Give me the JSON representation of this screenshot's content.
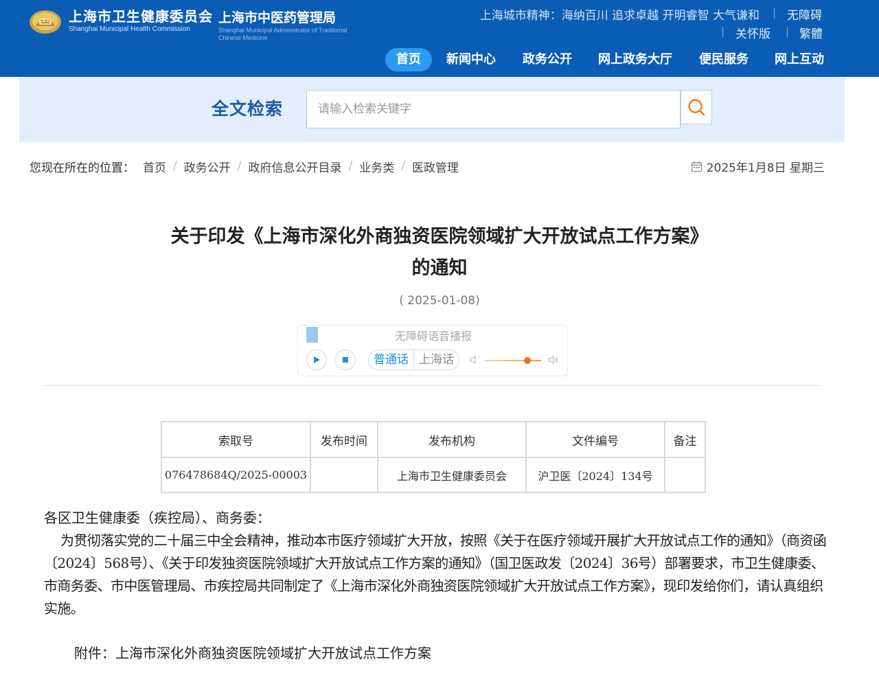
{
  "header": {
    "org_name": "上海市卫生健康委员会",
    "org_name_en": "Shanghai Municipal Health Commission",
    "org2_name": "上海市中医药管理局",
    "org2_name_en": "Shanghai Municipal Administrator of Traditional Chinese Medicine",
    "city_spirit": "上海城市精神：海纳百川 追求卓越 开明睿智 大气谦和",
    "accessibility_label": "无障碍",
    "care_label": "关怀版",
    "traditional_label": "繁體",
    "nav": [
      {
        "label": "首页"
      },
      {
        "label": "新闻中心"
      },
      {
        "label": "政务公开"
      },
      {
        "label": "网上政务大厅"
      },
      {
        "label": "便民服务"
      },
      {
        "label": "网上互动"
      }
    ],
    "colors": {
      "bar": "#0b5cb5",
      "active": "#2b9bf0"
    }
  },
  "search": {
    "title": "全文检索",
    "placeholder": "请输入检索关键字",
    "icon": "search-icon"
  },
  "breadcrumb": {
    "prefix": "您现在所在的位置：",
    "items": [
      {
        "label": "首页"
      },
      {
        "label": "政务公开"
      },
      {
        "label": "政府信息公开目录"
      },
      {
        "label": "业务类"
      },
      {
        "label": "医政管理"
      }
    ],
    "separator": "/"
  },
  "date_today": "2025年1月8日 星期三",
  "article": {
    "title_line1": "关于印发《上海市深化外商独资医院领域扩大开放试点工作方案》",
    "title_line2": "的通知",
    "pub_date": "( 2025-01-08)"
  },
  "audio": {
    "label": "无障碍语音播报",
    "lang_mandarin": "普通话",
    "lang_shanghai": "上海话",
    "volume_percent": 75
  },
  "meta_table": {
    "headers": [
      "索取号",
      "发布时间",
      "发布机构",
      "文件编号",
      "备注"
    ],
    "row": [
      "076478684Q/2025-00003",
      "",
      "上海市卫生健康委员会",
      "沪卫医〔2024〕134号",
      ""
    ]
  },
  "body": {
    "salutation": "各区卫生健康委（疾控局）、商务委：",
    "paragraph": "为贯彻落实党的二十届三中全会精神，推动本市医疗领域扩大开放，按照《关于在医疗领域开展扩大开放试点工作的通知》（商资函〔2024〕568号）、《关于印发独资医院领域扩大开放试点工作方案的通知》（国卫医政发〔2024〕36号）部署要求，市卫生健康委、市商务委、市中医管理局、市疾控局共同制定了《上海市深化外商独资医院领域扩大开放试点工作方案》，现印发给你们，请认真组织实施。",
    "attachment": "附件：上海市深化外商独资医院领域扩大开放试点工作方案"
  }
}
